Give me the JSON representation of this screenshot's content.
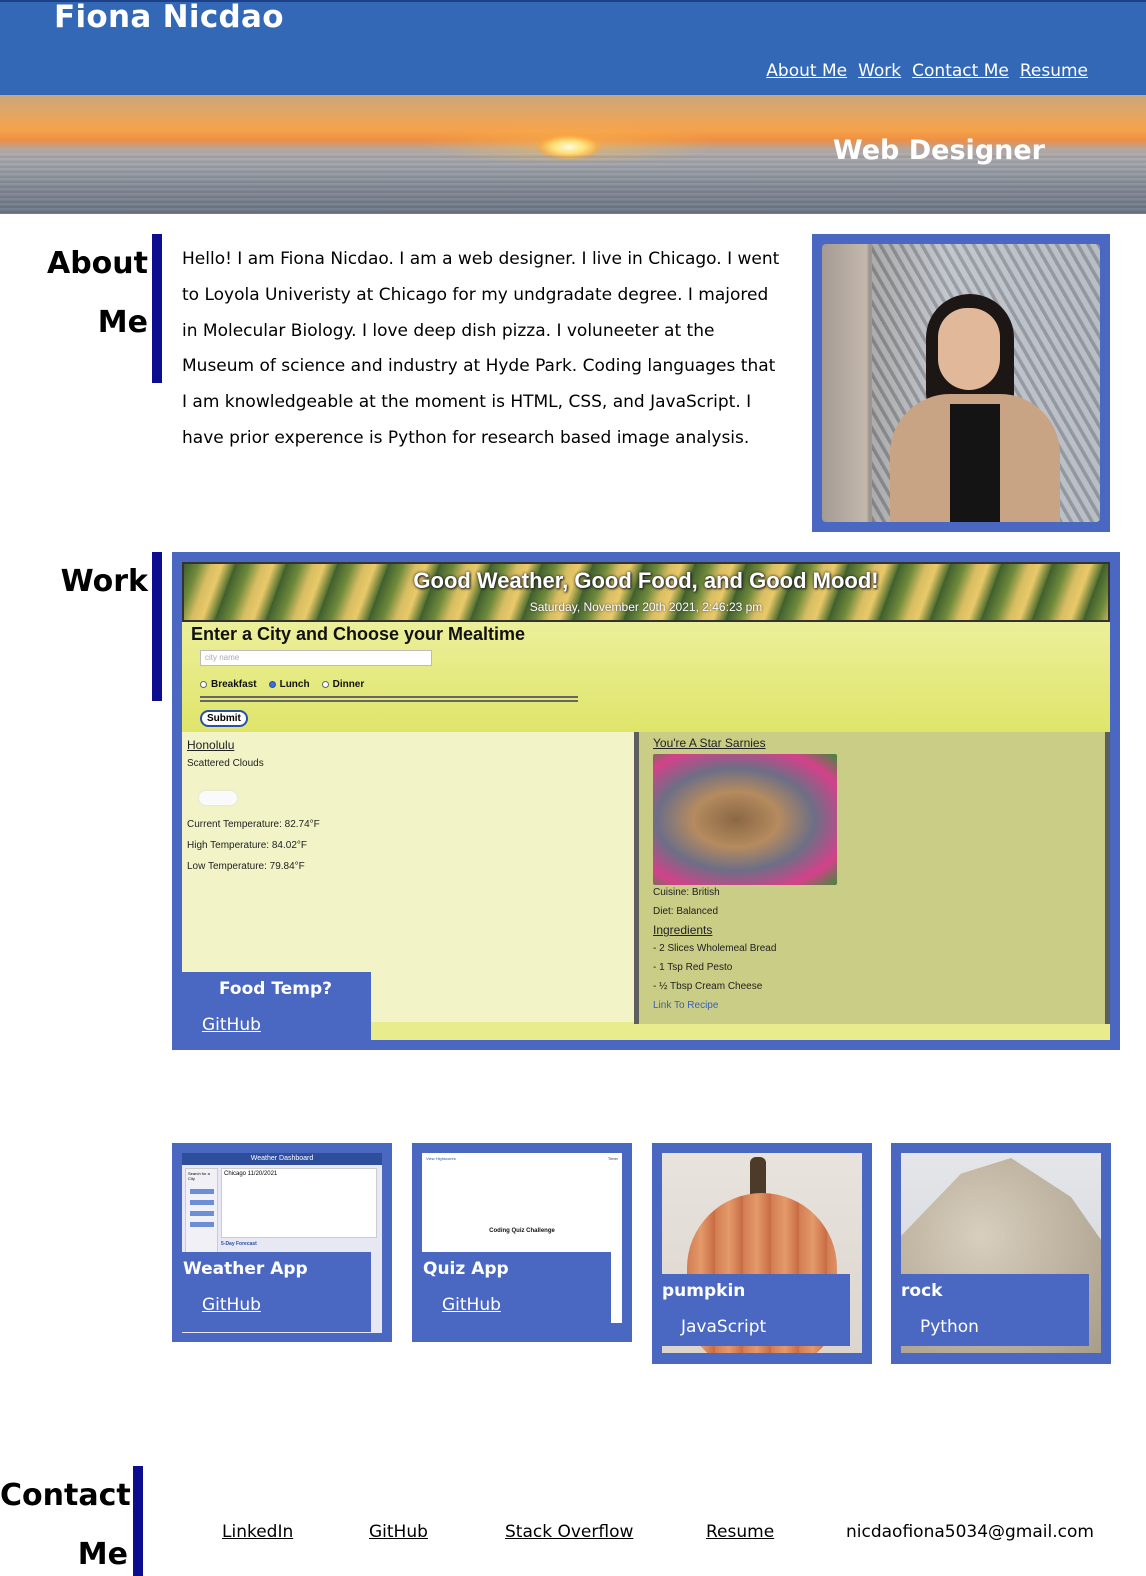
{
  "header": {
    "site_title": "Fiona Nicdao",
    "nav": [
      "About Me",
      "Work",
      "Contact Me",
      "Resume"
    ]
  },
  "hero": {
    "subtitle": "Web Designer"
  },
  "about": {
    "heading_line1": "About",
    "heading_line2": "Me",
    "text": "Hello! I am Fiona Nicdao. I am a web designer. I live in Chicago. I went to Loyola Univeristy at Chicago for my undgradate degree. I majored in Molecular Biology. I love deep dish pizza. I voluneeter at the Museum of science and industry at Hyde Park. Coding languages that I am knowledgeable at the moment is HTML, CSS, and JavaScript. I have prior experence is Python for research based image analysis."
  },
  "work": {
    "heading": "Work",
    "featured": {
      "label": "Food Temp?",
      "link": "GitHub",
      "screenshot": {
        "banner_title": "Good Weather, Good Food, and Good Mood!",
        "banner_date": "Saturday, November 20th 2021, 2:46:23 pm",
        "form_title": "Enter a City and Choose your Mealtime",
        "city_placeholder": "city name",
        "mealtimes": [
          "Breakfast",
          "Lunch",
          "Dinner"
        ],
        "selected_mealtime": "Lunch",
        "submit": "Submit",
        "city": "Honolulu",
        "conditions": "Scattered Clouds",
        "current_temp": "Current Temperature: 82.74°F",
        "high_temp": "High Temperature: 84.02°F",
        "low_temp": "Low Temperature: 79.84°F",
        "recipe_name": "You're A Star Sarnies",
        "cuisine": "Cuisine: British",
        "diet": "Diet: Balanced",
        "ingredients_heading": "Ingredients",
        "ingredients": [
          "- 2 Slices Wholemeal Bread",
          "- 1 Tsp Red Pesto",
          "- ½ Tbsp Cream Cheese"
        ],
        "recipe_link": "Link To Recipe"
      }
    },
    "cards": [
      {
        "label": "Weather App",
        "link": "GitHub",
        "screenshot": {
          "title": "Weather Dashboard",
          "side_title": "Search for a City",
          "city": "Chicago  11/20/2021",
          "forecast": "5-Day Forecast"
        }
      },
      {
        "label": "Quiz App",
        "link": "GitHub",
        "screenshot": {
          "top_left": "View Highscores",
          "top_right": "Timer",
          "title": "Coding Quiz Challenge"
        }
      },
      {
        "label": "pumpkin",
        "lang": "JavaScript"
      },
      {
        "label": "rock",
        "lang": "Python"
      }
    ]
  },
  "contact": {
    "heading_line1": "Contact",
    "heading_line2": "Me",
    "links": [
      "LinkedIn",
      "GitHub",
      "Stack Overflow",
      "Resume"
    ],
    "email": "nicdaofiona5034@gmail.com"
  }
}
